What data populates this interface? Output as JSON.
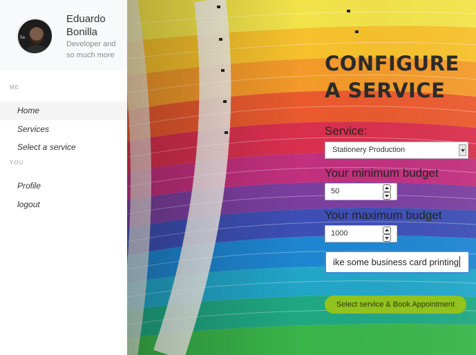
{
  "profile": {
    "name": "Eduardo Bonilla",
    "tagline": "Developer and so much more"
  },
  "sidebar": {
    "section_me": "ME",
    "section_you": "YOU",
    "items": [
      {
        "label": "Home",
        "active": true
      },
      {
        "label": "Services",
        "active": false
      },
      {
        "label": "Select a service",
        "active": false
      },
      {
        "label": "Profile",
        "active": false
      },
      {
        "label": "logout",
        "active": false
      }
    ]
  },
  "form": {
    "title": "CONFIGURE A SERVICE",
    "service_label": "Service:",
    "service_value": "Stationery Production",
    "min_budget_label": "Your minimum budget",
    "min_budget_value": "50",
    "max_budget_label": "Your maximum budget",
    "max_budget_value": "1000",
    "details_value": "ike some business card printing",
    "submit_label": "Select service & Book Appointment"
  },
  "colors": {
    "accent_button": "#92c21d",
    "focus_border": "#3d8bd9",
    "sidebar_bg": "#f8f9fa"
  }
}
